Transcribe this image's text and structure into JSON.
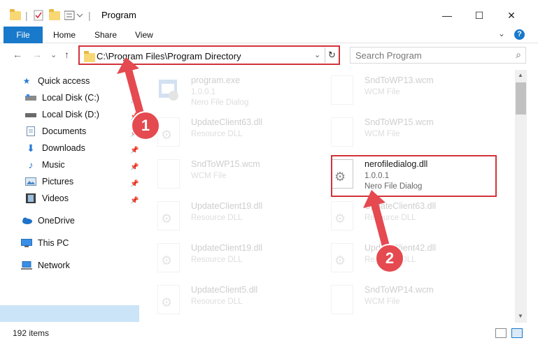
{
  "window": {
    "title": "Program",
    "minimize": "—",
    "maximize": "☐",
    "close": "✕"
  },
  "ribbon": {
    "file": "File",
    "tabs": [
      "Home",
      "Share",
      "View"
    ],
    "help": "?"
  },
  "address": {
    "path": "C:\\Program Files\\Program Directory",
    "refresh": "↻",
    "dropdown": "⌄"
  },
  "search": {
    "placeholder": "Search Program",
    "icon": "search-icon"
  },
  "nav": {
    "back": "←",
    "forward": "→",
    "recent": "⌄",
    "up": "↑"
  },
  "sidebar": {
    "items": [
      {
        "label": "Quick access",
        "icon": "star-icon"
      },
      {
        "label": "Local Disk (C:)",
        "icon": "drive-icon"
      },
      {
        "label": "Local Disk (D:)",
        "icon": "drive-icon"
      },
      {
        "label": "Documents",
        "icon": "documents-icon"
      },
      {
        "label": "Downloads",
        "icon": "download-icon"
      },
      {
        "label": "Music",
        "icon": "music-icon"
      },
      {
        "label": "Pictures",
        "icon": "pictures-icon"
      },
      {
        "label": "Videos",
        "icon": "videos-icon"
      },
      {
        "label": "OneDrive",
        "icon": "cloud-icon"
      },
      {
        "label": "This PC",
        "icon": "computer-icon"
      },
      {
        "label": "Network",
        "icon": "network-icon"
      }
    ]
  },
  "files": [
    {
      "name": "program.exe",
      "version": "1.0.0.1",
      "type": "Nero File Dialog"
    },
    {
      "name": "SndToWP13.wcm",
      "version": "",
      "type": "WCM File"
    },
    {
      "name": "UpdateClient63.dll",
      "version": "",
      "type": "Resource DLL"
    },
    {
      "name": "SndToWP15.wcm",
      "version": "",
      "type": "WCM File"
    },
    {
      "name": "SndToWP15.wcm",
      "version": "",
      "type": "WCM File"
    },
    {
      "name": "nerofiledialog.dll",
      "version": "1.0.0.1",
      "type": "Nero File Dialog"
    },
    {
      "name": "UpdateClient19.dll",
      "version": "",
      "type": "Resource DLL"
    },
    {
      "name": "UpdateClient63.dll",
      "version": "",
      "type": "Resource DLL"
    },
    {
      "name": "UpdateClient19.dll",
      "version": "",
      "type": "Resource DLL"
    },
    {
      "name": "UpdateClient42.dll",
      "version": "",
      "type": "Resource DLL"
    },
    {
      "name": "UpdateClient5.dll",
      "version": "",
      "type": "Resource DLL"
    },
    {
      "name": "SndToWP14.wcm",
      "version": "",
      "type": "WCM File"
    }
  ],
  "annotations": {
    "step1": "1",
    "step2": "2"
  },
  "status": {
    "count": "192 items"
  },
  "colors": {
    "accent": "#1979ca",
    "highlight": "#d2333a",
    "selected": "#cce4f7"
  }
}
